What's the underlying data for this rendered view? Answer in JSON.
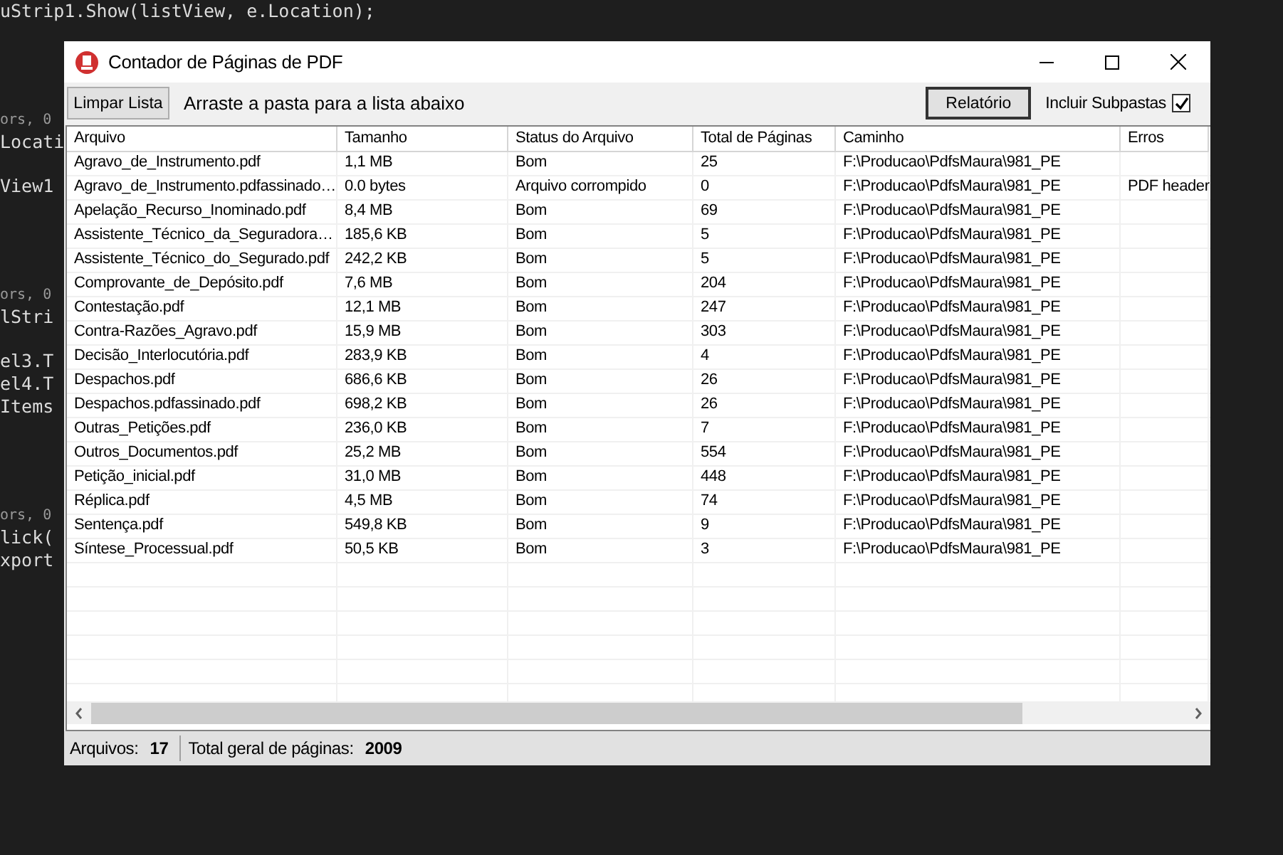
{
  "editor": {
    "lines": [
      {
        "kind": "code",
        "text": "uStrip1.Show(listView, e.Location);"
      },
      {
        "kind": "codelens",
        "text": "ors, 0"
      },
      {
        "kind": "code",
        "text": "Locati"
      },
      {
        "kind": "code",
        "text": "View1"
      },
      {
        "kind": "codelens",
        "text": "ors, 0"
      },
      {
        "kind": "code",
        "text": "lStri"
      },
      {
        "kind": "code",
        "text": "el3.T"
      },
      {
        "kind": "code",
        "text": "el4.T"
      },
      {
        "kind": "code",
        "text": "Items"
      },
      {
        "kind": "codelens",
        "text": "ors, 0"
      },
      {
        "kind": "code",
        "text": "lick("
      },
      {
        "kind": "code",
        "text": "xport"
      }
    ]
  },
  "window": {
    "title": "Contador de Páginas de PDF"
  },
  "toolbar": {
    "clear_button": "Limpar Lista",
    "hint": "Arraste a pasta para a lista abaixo",
    "report_button": "Relatório",
    "subfolders": {
      "label": "Incluir Subpastas",
      "checked": true
    }
  },
  "table": {
    "columns": [
      "Arquivo",
      "Tamanho",
      "Status do Arquivo",
      "Total de Páginas",
      "Caminho",
      "Erros"
    ],
    "rows": [
      [
        "Agravo_de_Instrumento.pdf",
        "1,1 MB",
        "Bom",
        "25",
        "F:\\Producao\\PdfsMaura\\981_PE"
      ],
      [
        "Agravo_de_Instrumento.pdfassinado…",
        "0.0 bytes",
        "Arquivo corrompido",
        "0",
        "F:\\Producao\\PdfsMaura\\981_PE",
        "PDF header"
      ],
      [
        "Apelação_Recurso_Inominado.pdf",
        "8,4 MB",
        "Bom",
        "69",
        "F:\\Producao\\PdfsMaura\\981_PE"
      ],
      [
        "Assistente_Técnico_da_Seguradora…",
        "185,6 KB",
        "Bom",
        "5",
        "F:\\Producao\\PdfsMaura\\981_PE"
      ],
      [
        "Assistente_Técnico_do_Segurado.pdf",
        "242,2 KB",
        "Bom",
        "5",
        "F:\\Producao\\PdfsMaura\\981_PE"
      ],
      [
        "Comprovante_de_Depósito.pdf",
        "7,6 MB",
        "Bom",
        "204",
        "F:\\Producao\\PdfsMaura\\981_PE"
      ],
      [
        "Contestação.pdf",
        "12,1 MB",
        "Bom",
        "247",
        "F:\\Producao\\PdfsMaura\\981_PE"
      ],
      [
        "Contra-Razões_Agravo.pdf",
        "15,9 MB",
        "Bom",
        "303",
        "F:\\Producao\\PdfsMaura\\981_PE"
      ],
      [
        "Decisão_Interlocutória.pdf",
        "283,9 KB",
        "Bom",
        "4",
        "F:\\Producao\\PdfsMaura\\981_PE"
      ],
      [
        "Despachos.pdf",
        "686,6 KB",
        "Bom",
        "26",
        "F:\\Producao\\PdfsMaura\\981_PE"
      ],
      [
        "Despachos.pdfassinado.pdf",
        "698,2 KB",
        "Bom",
        "26",
        "F:\\Producao\\PdfsMaura\\981_PE"
      ],
      [
        "Outras_Petições.pdf",
        "236,0 KB",
        "Bom",
        "7",
        "F:\\Producao\\PdfsMaura\\981_PE"
      ],
      [
        "Outros_Documentos.pdf",
        "25,2 MB",
        "Bom",
        "554",
        "F:\\Producao\\PdfsMaura\\981_PE"
      ],
      [
        "Petição_inicial.pdf",
        "31,0 MB",
        "Bom",
        "448",
        "F:\\Producao\\PdfsMaura\\981_PE"
      ],
      [
        "Réplica.pdf",
        "4,5 MB",
        "Bom",
        "74",
        "F:\\Producao\\PdfsMaura\\981_PE"
      ],
      [
        "Sentença.pdf",
        "549,8 KB",
        "Bom",
        "9",
        "F:\\Producao\\PdfsMaura\\981_PE"
      ],
      [
        "Síntese_Processual.pdf",
        "50,5 KB",
        "Bom",
        "3",
        "F:\\Producao\\PdfsMaura\\981_PE"
      ]
    ]
  },
  "status_bar": {
    "files_label": "Arquivos:",
    "files_count": "17",
    "pages_label": "Total geral de páginas:",
    "pages_total": "2009"
  }
}
